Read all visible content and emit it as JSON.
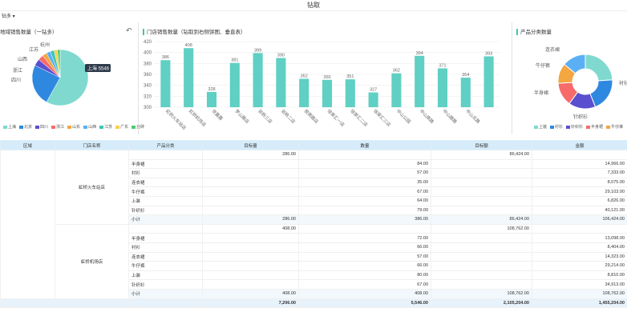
{
  "app": {
    "title": "钻取",
    "drill_label": "钻多 ▾"
  },
  "panels": {
    "left": {
      "title": "地域销售数量（一钻多）",
      "tooltip": "上海 5546",
      "labels": [
        "杭州",
        "江苏",
        "山西",
        "浙江",
        "四川",
        "上海"
      ],
      "legend": [
        "上海",
        "北京",
        "四川",
        "浙江",
        "山东",
        "山西",
        "江苏",
        "广东",
        "金砖"
      ]
    },
    "middle": {
      "title": "门店销售数量（钻取到右侧饼图、垂直表）"
    },
    "right": {
      "title": "产品分类数量",
      "labels": [
        "连衣裙",
        "牛仔裤",
        "半身裙",
        "衬衫",
        "针织衫"
      ],
      "legend": [
        "上装",
        "衬衫",
        "针织衫",
        "半身裙",
        "牛仔裤"
      ]
    }
  },
  "colors": {
    "accent": "#3ec5b5",
    "header_bg": "#d6ecfa"
  },
  "chart_data": [
    {
      "type": "pie",
      "title": "地域销售数量（一钻多）",
      "slices": [
        {
          "name": "上海",
          "value": 5546,
          "color": "#7fd9cf"
        },
        {
          "name": "北京",
          "value": 2300,
          "color": "#2f88e0"
        },
        {
          "name": "四川",
          "value": 380,
          "color": "#5a4fcf"
        },
        {
          "name": "浙江",
          "value": 300,
          "color": "#f86b6b"
        },
        {
          "name": "山东",
          "value": 240,
          "color": "#f4a640"
        },
        {
          "name": "山西",
          "value": 230,
          "color": "#5bb0f5"
        },
        {
          "name": "江苏",
          "value": 220,
          "color": "#3ec5b5"
        },
        {
          "name": "广东",
          "value": 180,
          "color": "#f9d048"
        },
        {
          "name": "金砖",
          "value": 150,
          "color": "#4ecb73"
        }
      ]
    },
    {
      "type": "bar",
      "title": "门店销售数量（钻取到右侧饼图、垂直表）",
      "categories": [
        "虹桥火车站店",
        "虹桥机场店",
        "世嘉嘉",
        "罗山路店",
        "张杨三店",
        "张杨二店",
        "胶南路店",
        "徐家汇一店",
        "徐家汇二店",
        "徐家汇三店",
        "中山公园",
        "中山南路",
        "中山路路",
        "中山北路"
      ],
      "values": [
        386,
        408,
        328,
        381,
        399,
        390,
        352,
        350,
        351,
        327,
        362,
        394,
        371,
        354,
        393
      ],
      "ylim": [
        300,
        420
      ],
      "yticks": [
        300,
        320,
        340,
        360,
        380,
        400,
        420
      ]
    },
    {
      "type": "pie",
      "title": "产品分类数量",
      "slices": [
        {
          "name": "上装",
          "value": 24,
          "color": "#7fd9cf"
        },
        {
          "name": "衬衫",
          "value": 20,
          "color": "#2f88e0"
        },
        {
          "name": "针织衫",
          "value": 16,
          "color": "#5a4fcf"
        },
        {
          "name": "半身裙",
          "value": 14,
          "color": "#f86b6b"
        },
        {
          "name": "牛仔裤",
          "value": 12,
          "color": "#f4a640"
        },
        {
          "name": "连衣裙",
          "value": 14,
          "color": "#5bb0f5"
        }
      ]
    }
  ],
  "table": {
    "headers": [
      "区域",
      "门店名称",
      "产品分类",
      "目标量",
      "数量",
      "目标额",
      "金额"
    ],
    "groups": [
      {
        "store": "虹桥火车站店",
        "target_qty": "286.00",
        "target_amt": "86,424.00",
        "rows": [
          [
            "半身裙",
            "84.00",
            "14,966.00"
          ],
          [
            "衬衫",
            "57.00",
            "7,333.00"
          ],
          [
            "连衣裙",
            "35.00",
            "8,075.00"
          ],
          [
            "牛仔裤",
            "67.00",
            "29,103.00"
          ],
          [
            "上装",
            "64.00",
            "6,826.00"
          ],
          [
            "针织衫",
            "79.00",
            "40,121.00"
          ]
        ],
        "subtotal": [
          "小计",
          "286.00",
          "386.00",
          "86,424.00",
          "106,424.00"
        ]
      },
      {
        "store": "虹桥机场店",
        "target_qty": "408.00",
        "target_amt": "108,762.00",
        "rows": [
          [
            "半身裙",
            "72.00",
            "13,098.00"
          ],
          [
            "衬衫",
            "66.00",
            "8,404.00"
          ],
          [
            "连衣裙",
            "57.00",
            "14,323.00"
          ],
          [
            "牛仔裤",
            "66.00",
            "29,214.00"
          ],
          [
            "上装",
            "80.00",
            "8,810.00"
          ],
          [
            "针织衫",
            "67.00",
            "34,913.00"
          ]
        ],
        "subtotal": [
          "小计",
          "408.00",
          "408.00",
          "108,762.00",
          "108,762.00"
        ]
      }
    ],
    "total": [
      "7,206.00",
      "5,546.00",
      "2,105,204.00",
      "1,455,204.00"
    ]
  }
}
